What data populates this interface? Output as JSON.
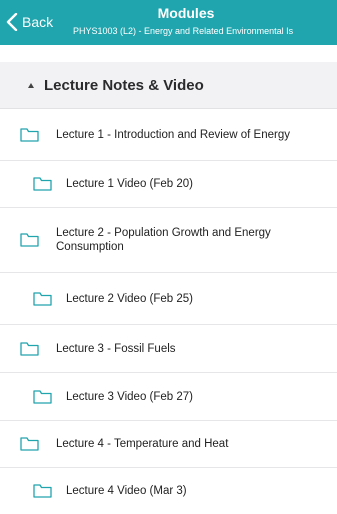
{
  "header": {
    "back_label": "Back",
    "title": "Modules",
    "subtitle": "PHYS1003 (L2) - Energy and Related Environmental Is"
  },
  "section": {
    "title": "Lecture Notes & Video"
  },
  "items": [
    {
      "label": "Lecture 1 - Introduction and Review of Energy"
    },
    {
      "label": "Lecture 1 Video (Feb 20)"
    },
    {
      "label": "Lecture 2 - Population Growth and Energy Consumption"
    },
    {
      "label": "Lecture 2 Video (Feb 25)"
    },
    {
      "label": "Lecture 3 - Fossil Fuels"
    },
    {
      "label": "Lecture 3 Video (Feb 27)"
    },
    {
      "label": "Lecture 4 - Temperature and Heat"
    },
    {
      "label": "Lecture 4 Video (Mar 3)"
    }
  ],
  "icons": {
    "back": "chevron-left-icon",
    "section_toggle": "caret-up-icon",
    "item": "folder-icon"
  },
  "colors": {
    "header": "#20a5ae",
    "folder_icon": "#20a5ae",
    "section_background": "#f2f2f4"
  }
}
